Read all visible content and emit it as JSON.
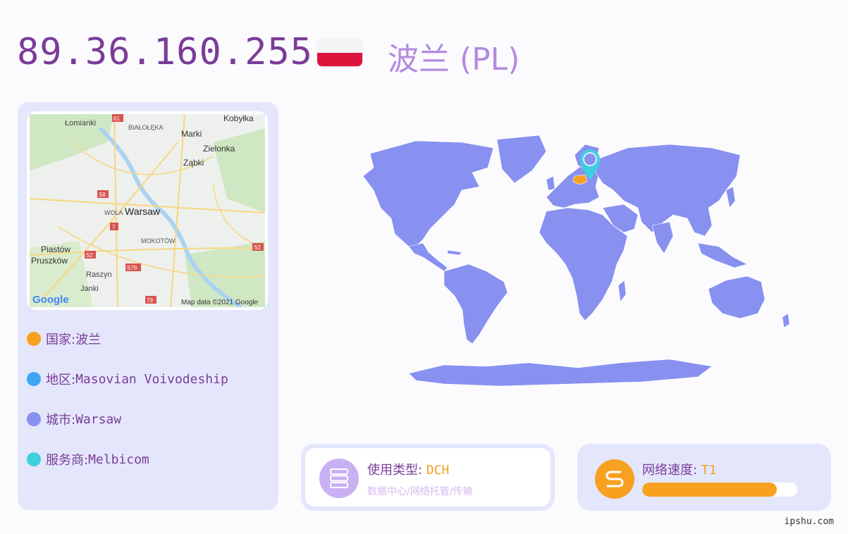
{
  "header": {
    "ip": "89.36.160.255",
    "country_title": "波兰 (PL)",
    "flag_colors": [
      "#f4f4f4",
      "#dc143c"
    ]
  },
  "map": {
    "labels": [
      "Łomianki",
      "BIAŁOŁĘKA",
      "Kobyłka",
      "Marki",
      "Zielonka",
      "Ząbki",
      "WOLA",
      "Warsaw",
      "MOKOTÓW",
      "Piastów",
      "Pruszków",
      "Raszyn",
      "Janki"
    ],
    "road_badges": [
      "61",
      "S8",
      "7",
      "S2",
      "S79",
      "S2",
      "79"
    ],
    "logo": "Google",
    "attribution": "Map data ©2021 Google"
  },
  "info": [
    {
      "label": "国家: ",
      "value": "波兰",
      "color": "#f8a020"
    },
    {
      "label": "地区: ",
      "value": "Masovian Voivodeship",
      "color": "#3fa6f5"
    },
    {
      "label": "城市: ",
      "value": "Warsaw",
      "color": "#8890f0"
    },
    {
      "label": "服务商: ",
      "value": "Melbicom",
      "color": "#3fd0e0"
    }
  ],
  "usage": {
    "title": "使用类型: ",
    "value": "DCH",
    "subtitle": "数据中心/网络托管/传输",
    "icon": "server-icon"
  },
  "speed": {
    "title": "网络速度: ",
    "value": "T1",
    "progress_fraction": 0.87,
    "icon": "speed-icon"
  },
  "footer": "ipshu.com",
  "colors": {
    "accent_purple": "#7a3c98",
    "map_land": "#8890f0",
    "highlight": "#f8a020",
    "marker": "#3fd0e0"
  }
}
